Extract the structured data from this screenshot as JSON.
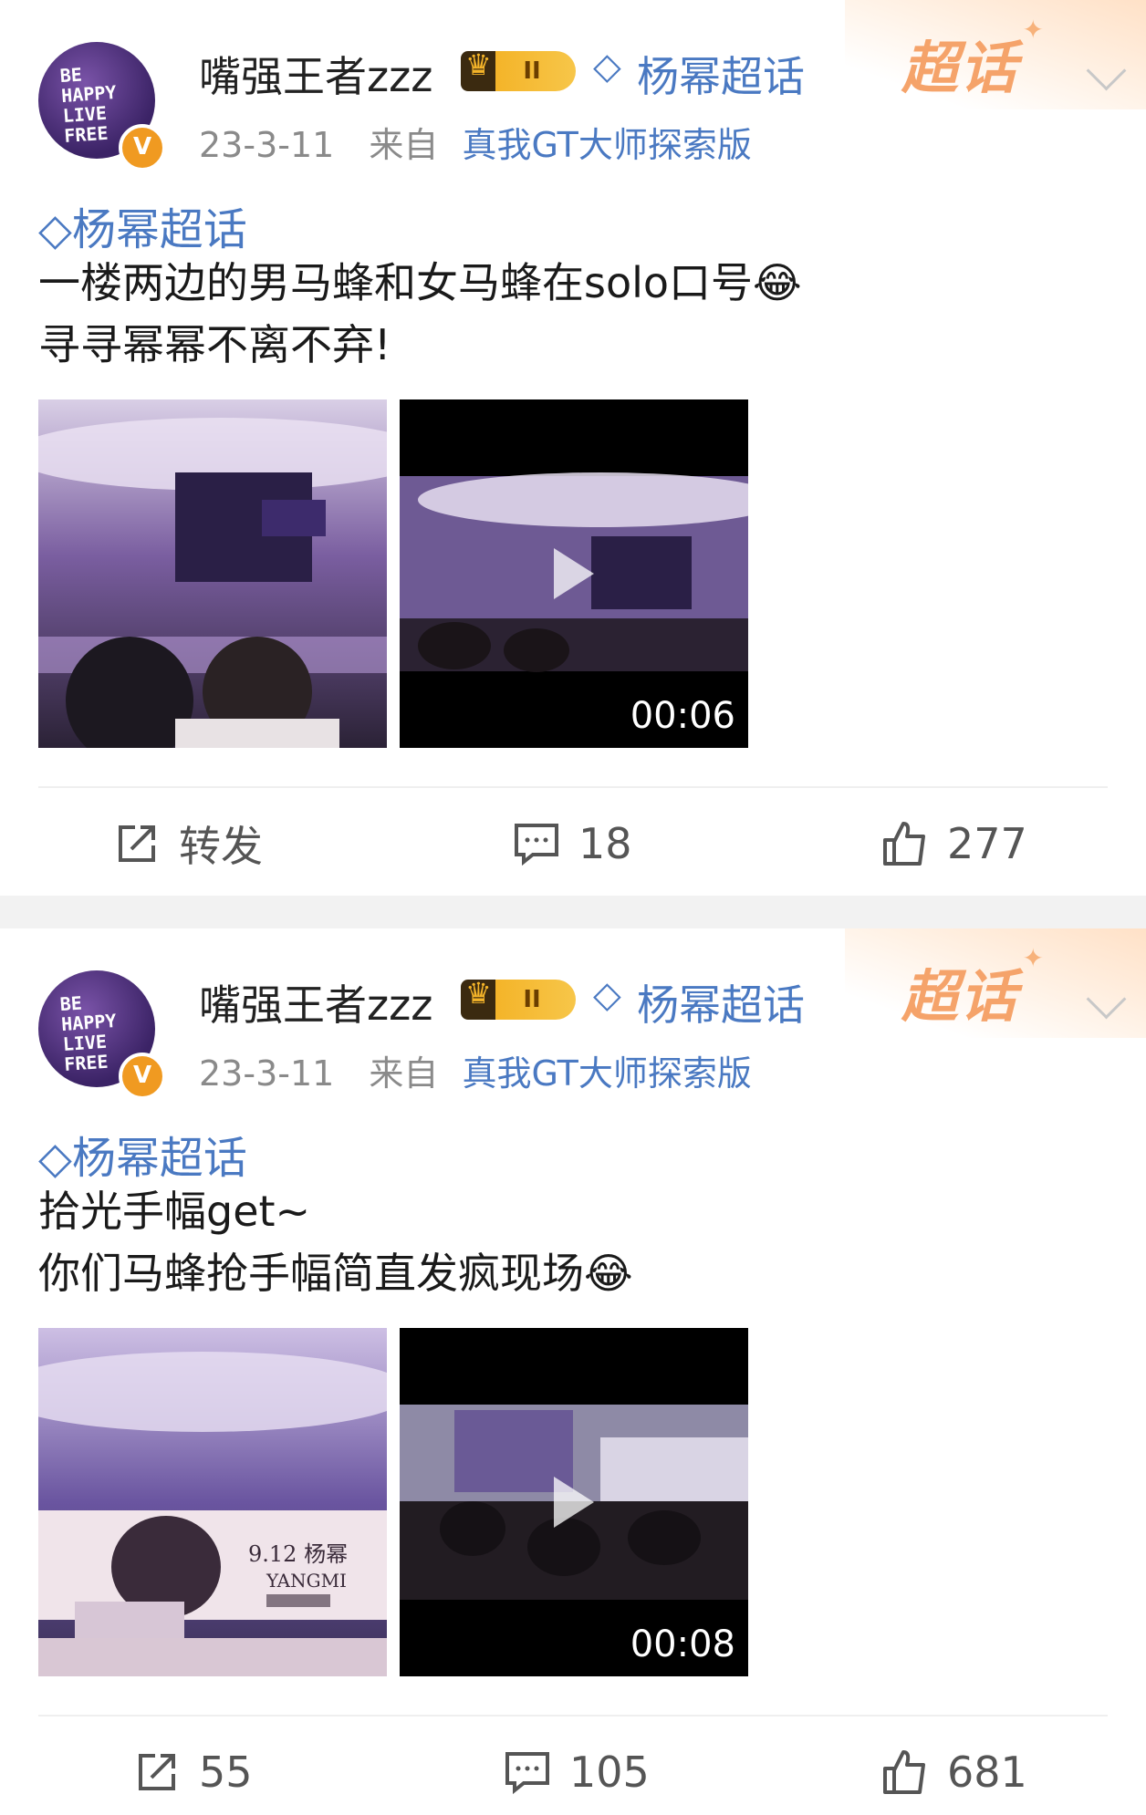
{
  "posts": [
    {
      "username": "嘴强王者zzz",
      "badge": "II",
      "topic_head": "杨幂超话",
      "date": "23-3-11",
      "from": "来自",
      "device": "真我GT大师探索版",
      "topic_tag": "杨幂超话",
      "lines": [
        "一楼两边的男马蜂和女马蜂在solo口号😂",
        "寻寻幂幂不离不弃!"
      ],
      "video_duration": "00:06",
      "repost": "转发",
      "comments": "18",
      "likes": "277"
    },
    {
      "username": "嘴强王者zzz",
      "badge": "II",
      "topic_head": "杨幂超话",
      "date": "23-3-11",
      "from": "来自",
      "device": "真我GT大师探索版",
      "topic_tag": "杨幂超话",
      "lines": [
        "拾光手幅get~",
        "你们马蜂抢手幅简直发疯现场😂"
      ],
      "video_duration": "00:08",
      "repost": "55",
      "comments": "105",
      "likes": "681"
    }
  ],
  "chaohua_label": "超话",
  "avatar_text": [
    "BE",
    "HAPPY",
    "LIVE",
    "FREE"
  ],
  "verified_mark": "V",
  "banner_text": [
    "9.12 杨幂",
    "YANGMI"
  ],
  "colors": {
    "link": "#4a79c2",
    "accent": "#f5a36a",
    "muted": "#8a8a8a"
  },
  "icons": [
    "crown-icon",
    "diamond-icon",
    "chevron-down-icon",
    "share-icon",
    "comment-icon",
    "like-icon",
    "play-icon"
  ]
}
